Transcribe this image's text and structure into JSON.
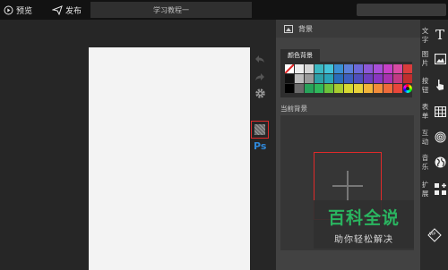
{
  "topbar": {
    "preview_label": "预览",
    "publish_label": "发布",
    "title": "学习教程一"
  },
  "tools": {
    "ps_label": "Ps"
  },
  "panel": {
    "header_title": "背景",
    "tab_label": "颜色背景",
    "current_bg_label": "当前背景",
    "swatches": [
      "none",
      "#eeeeee",
      "#d6d6d6",
      "#3cb8c2",
      "#43c2d8",
      "#3a8fd3",
      "#5b7fd9",
      "#6b68d8",
      "#8c58d6",
      "#a84ed8",
      "#c640c7",
      "#d84aa3",
      "#d93c3c",
      "#111111",
      "#bdbdbd",
      "#9a9a9a",
      "#2e9fa7",
      "#2aa3b8",
      "#2a6dbb",
      "#3d5fbf",
      "#4f4fbd",
      "#6d3fbf",
      "#8a36c2",
      "#a832b0",
      "#c23a84",
      "#c12e2e",
      "#000000",
      "#6a6a6a",
      "#27a35a",
      "#2fb85b",
      "#6cc23a",
      "#a8cc2f",
      "#d6d832",
      "#e8d23a",
      "#f2b43a",
      "#f28c3a",
      "#ee6a3a",
      "#e8463a",
      "wheel"
    ]
  },
  "sidebar": {
    "items": [
      {
        "label": "文字",
        "icon": "text-icon"
      },
      {
        "label": "图片",
        "icon": "image-icon"
      },
      {
        "label": "按钮",
        "icon": "hand-pointer-icon"
      },
      {
        "label": "表单",
        "icon": "table-icon"
      },
      {
        "label": "互动",
        "icon": "fingerprint-icon"
      },
      {
        "label": "音乐",
        "icon": "globe-icon"
      },
      {
        "label": "扩展",
        "icon": "grid-plus-icon"
      }
    ],
    "vip_label": "VIP"
  },
  "watermark": {
    "title": "百科全说",
    "subtitle": "助你轻松解决"
  }
}
